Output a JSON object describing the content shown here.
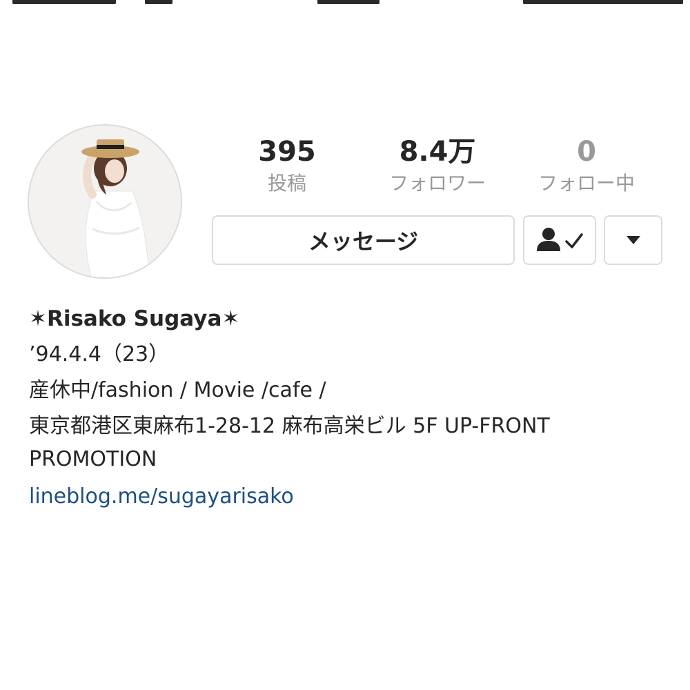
{
  "profile": {
    "avatar_icon": "profile-photo-avatar",
    "stats": {
      "posts": {
        "count": "395",
        "label": "投稿"
      },
      "followers": {
        "count": "8.4万",
        "label": "フォロワー"
      },
      "following": {
        "count": "0",
        "label": "フォロー中"
      }
    },
    "actions": {
      "message_label": "メッセージ",
      "following_icon": "person-check-icon",
      "dropdown_icon": "triangle-down-icon"
    },
    "bio": {
      "name": "✶Risako Sugaya✶",
      "birthday": "’94.4.4（23）",
      "tags": "産休中/fashion / Movie /cafe /",
      "address": "東京都港区東麻布1-28-12 麻布高栄ビル 5F UP-FRONT PROMOTION",
      "link": "lineblog.me/sugayarisako"
    }
  },
  "colors": {
    "text": "#262626",
    "muted": "#999999",
    "border": "#dbdbdb",
    "link": "#1d4f82"
  }
}
